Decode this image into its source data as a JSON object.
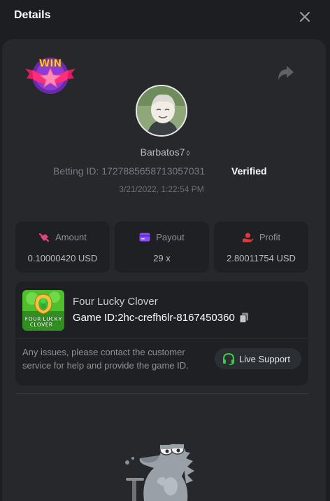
{
  "modal": {
    "title": "Details"
  },
  "bet": {
    "username": "Barbatos7",
    "betting_id_label": "Betting ID:",
    "betting_id": "1727885658713057031",
    "verified_label": "Verified",
    "datetime": "3/21/2022, 1:22:54 PM",
    "win_badge_text": "WIN"
  },
  "stats": [
    {
      "label": "Amount",
      "value": "0.10000420 USD",
      "icon": "amount-icon"
    },
    {
      "label": "Payout",
      "value": "29 x",
      "icon": "payout-card-icon"
    },
    {
      "label": "Profit",
      "value": "2.80011754 USD",
      "icon": "profit-hand-icon"
    }
  ],
  "game": {
    "name": "Four Lucky Clover",
    "id_label": "Game ID:",
    "id_value": "2hc-crefh6lr-8167450360",
    "thumb_text_line1": "FOUR LUCKY",
    "thumb_text_line2": "CLOVER"
  },
  "support": {
    "message": "Any issues, please contact the customer service for help and provide the game ID.",
    "button_label": "Live Support"
  },
  "colors": {
    "background": "#1c1e22",
    "card": "#26282c",
    "stat_box": "#1e2024",
    "amount_icon": "#e0457b",
    "payout_icon": "#8a4dff",
    "profit_icon": "#e5383b",
    "support_icon": "#3fc94b"
  }
}
